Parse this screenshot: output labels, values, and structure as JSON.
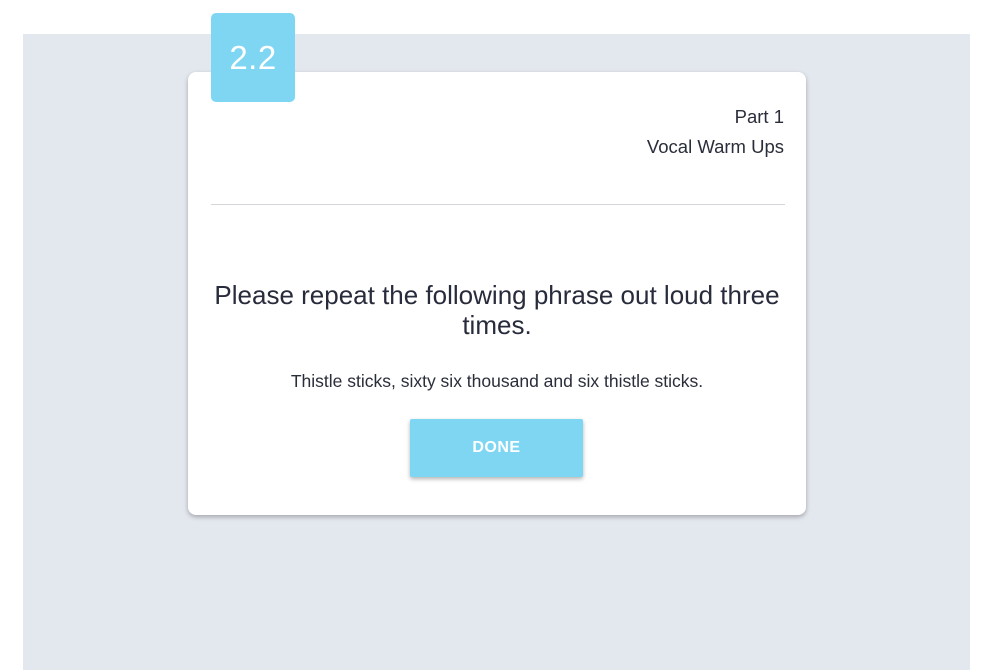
{
  "step": {
    "number": "2.2"
  },
  "part": {
    "label": "Part 1",
    "title": "Vocal Warm Ups"
  },
  "instruction": {
    "prompt": "Please repeat the following phrase out loud three times.",
    "phrase": "Thistle sticks, sixty six thousand and six thistle sticks."
  },
  "actions": {
    "done_label": "DONE"
  },
  "colors": {
    "accent": "#7fd6f3",
    "background": "#e3e7ee",
    "card": "#ffffff",
    "text": "#282b3b"
  }
}
